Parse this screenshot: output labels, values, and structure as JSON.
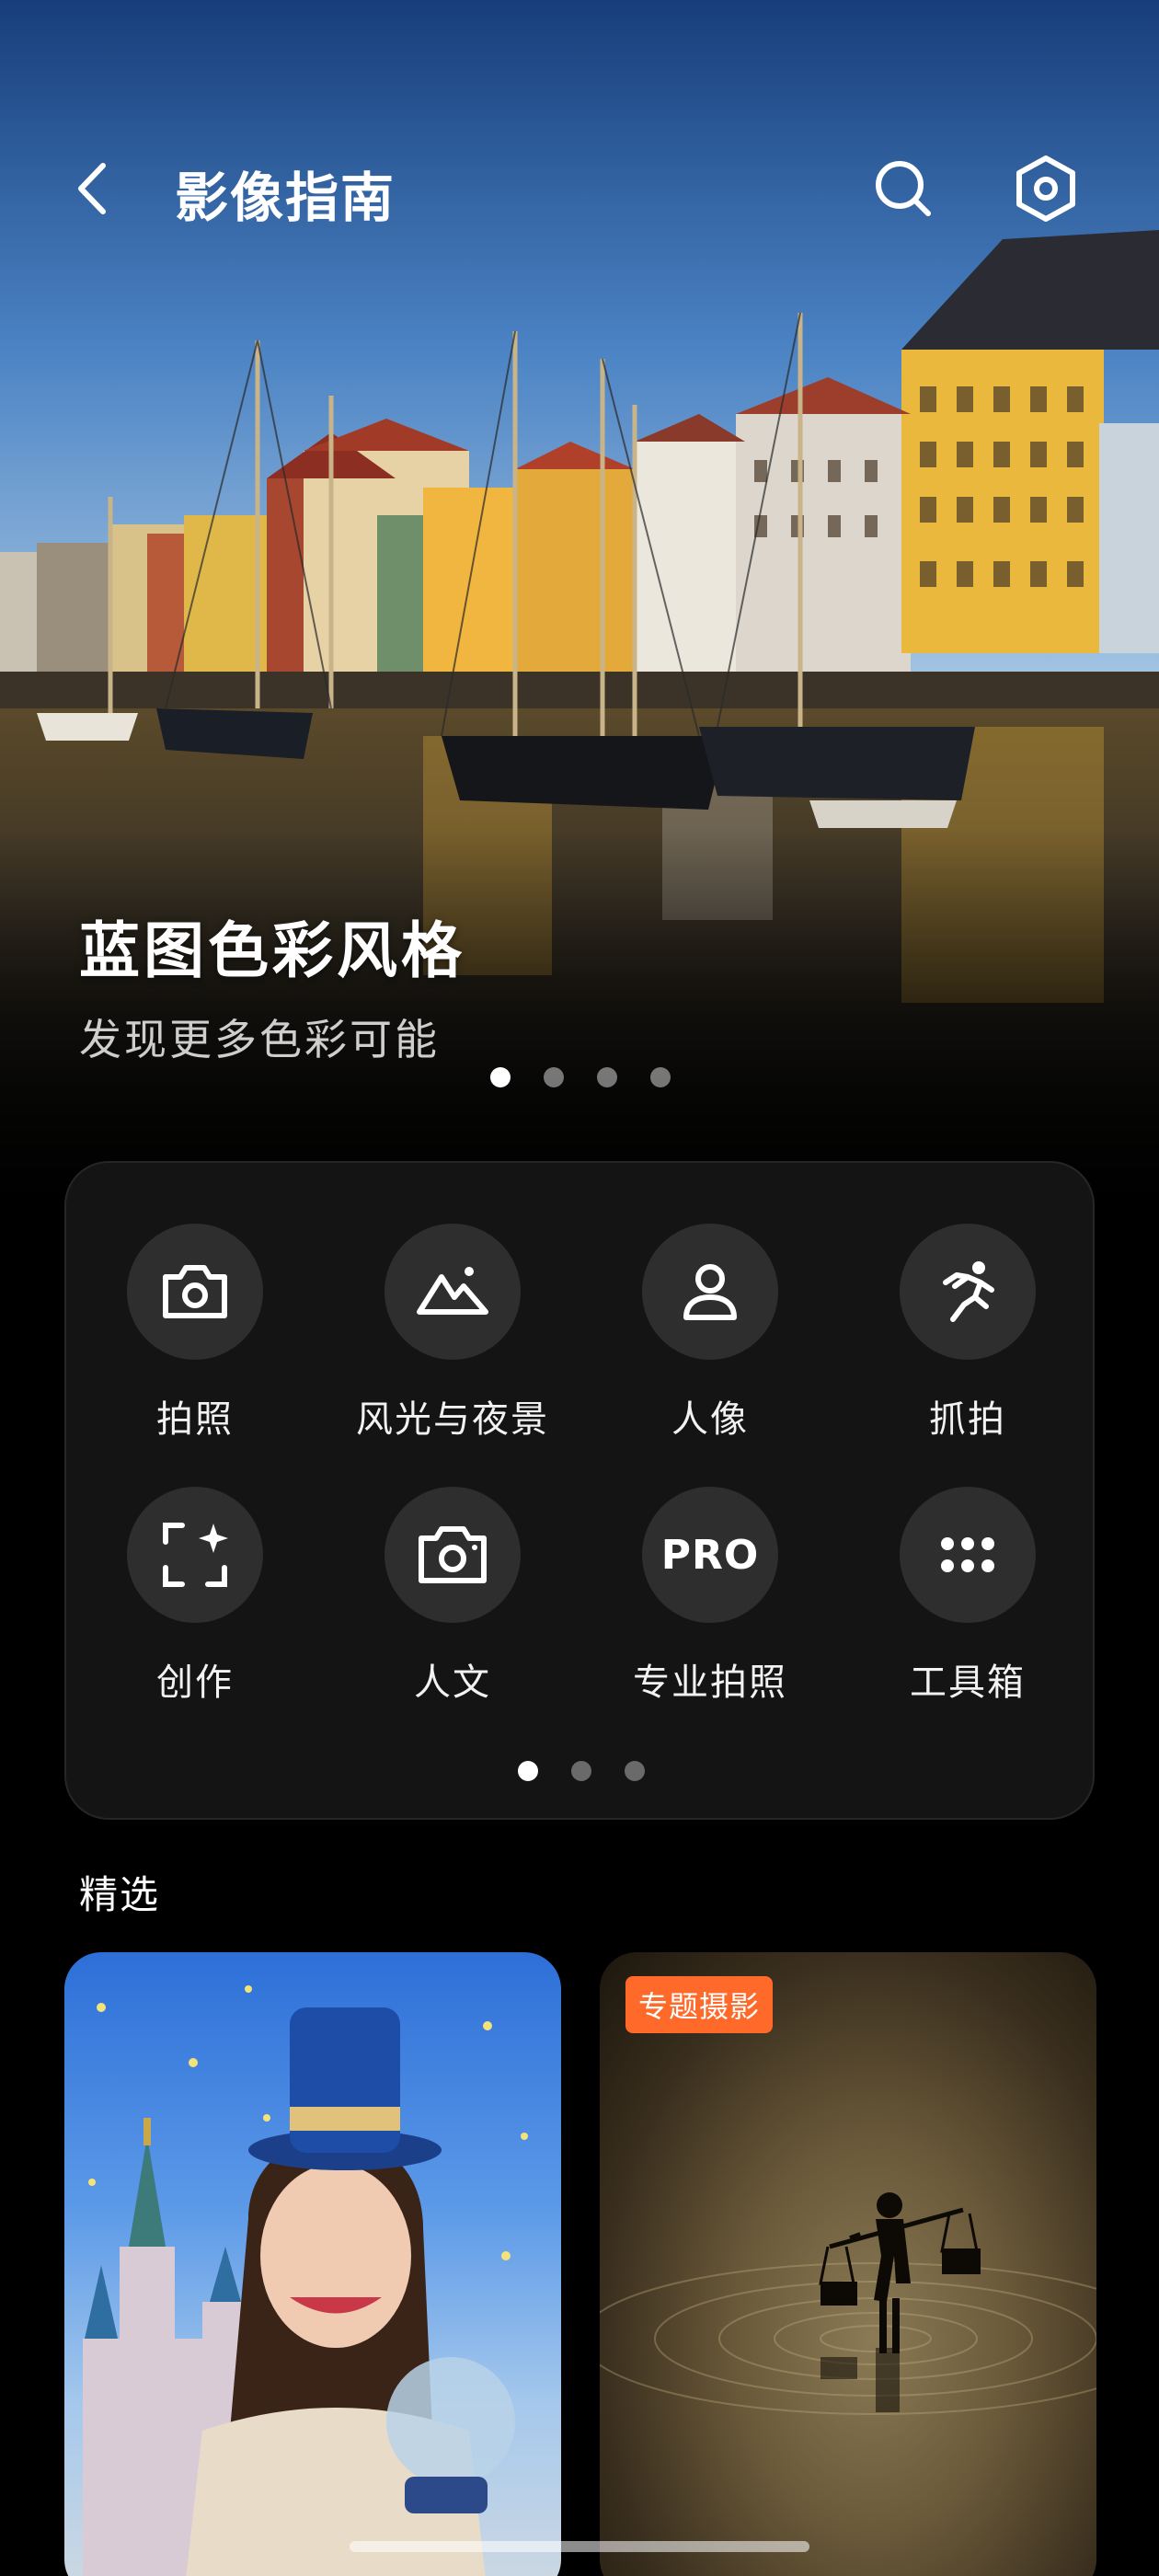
{
  "header": {
    "title": "影像指南"
  },
  "hero": {
    "title": "蓝图色彩风格",
    "subtitle": "发现更多色彩可能",
    "page_count": 4,
    "active_page": 1
  },
  "modes": {
    "items": [
      {
        "label": "拍照",
        "icon": "camera-icon"
      },
      {
        "label": "风光与夜景",
        "icon": "mountain-icon"
      },
      {
        "label": "人像",
        "icon": "person-icon"
      },
      {
        "label": "抓拍",
        "icon": "running-icon"
      },
      {
        "label": "创作",
        "icon": "sparkle-frame-icon"
      },
      {
        "label": "人文",
        "icon": "camera-outline-icon"
      },
      {
        "label": "专业拍照",
        "icon": "pro-icon",
        "icon_text": "PRO"
      },
      {
        "label": "工具箱",
        "icon": "grid-dots-icon"
      }
    ],
    "page_count": 3,
    "active_page": 1
  },
  "featured": {
    "title": "精选",
    "cards": [
      {
        "name": "castle-portrait"
      },
      {
        "name": "lake-silhouette",
        "badge": "专题摄影"
      }
    ]
  },
  "colors": {
    "background": "#000000",
    "panel": "#141414",
    "icon_circle": "#2e2e2e",
    "badge": "#ff6a2a"
  }
}
